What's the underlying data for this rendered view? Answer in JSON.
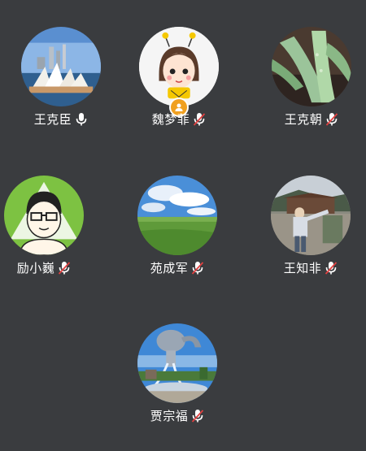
{
  "participants": [
    {
      "name": "王克臣",
      "mic": "mic-on-icon",
      "avatar": "sydney-opera-house-avatar"
    },
    {
      "name": "魏梦菲",
      "mic": "mic-muted-icon",
      "avatar": "cartoon-girl-avatar",
      "host": true
    },
    {
      "name": "王克朝",
      "mic": "mic-muted-icon",
      "avatar": "succulent-plant-avatar"
    },
    {
      "name": "励小巍",
      "mic": "mic-muted-icon",
      "avatar": "cartoon-glasses-man-avatar"
    },
    {
      "name": "苑成军",
      "mic": "mic-muted-icon",
      "avatar": "grassland-sky-avatar"
    },
    {
      "name": "王知非",
      "mic": "mic-muted-icon",
      "avatar": "park-person-avatar"
    },
    {
      "name": "贾宗福",
      "mic": "mic-muted-icon",
      "avatar": "teapot-fountain-avatar"
    }
  ],
  "colors": {
    "background": "#3a3c3f",
    "muted_slash": "#e04040",
    "mic": "#ffffff",
    "host_badge": "#f0a020"
  }
}
